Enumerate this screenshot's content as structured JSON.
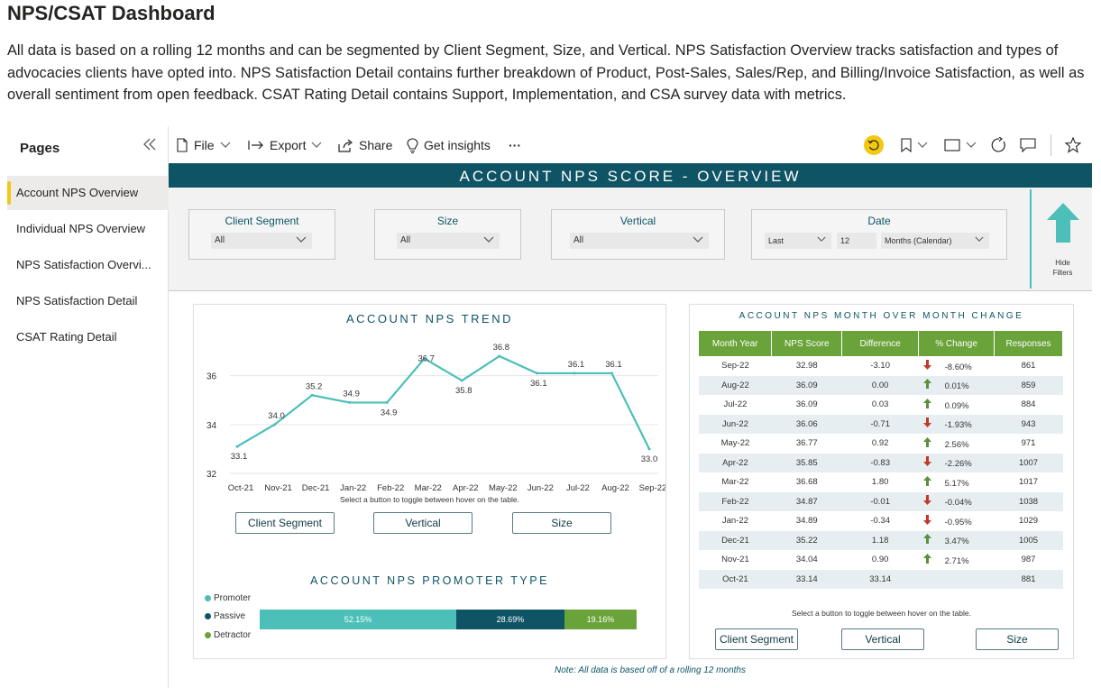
{
  "page": {
    "title": "NPS/CSAT Dashboard",
    "description": "All data is based on a rolling 12 months and can be segmented by Client Segment, Size, and Vertical. NPS Satisfaction Overview tracks satisfaction and types of advocacies clients have opted into. NPS Satisfaction Detail contains further breakdown of Product, Post-Sales, Sales/Rep, and Billing/Invoice Satisfaction, as well as overall sentiment from open feedback. CSAT Rating Detail contains Support, Implementation, and CSA survey data with metrics."
  },
  "pages_panel": {
    "header": "Pages",
    "items": [
      {
        "label": "Account NPS Overview",
        "active": true
      },
      {
        "label": "Individual NPS Overview",
        "active": false
      },
      {
        "label": "NPS Satisfaction Overvi...",
        "active": false
      },
      {
        "label": "NPS Satisfaction Detail",
        "active": false
      },
      {
        "label": "CSAT Rating Detail",
        "active": false
      }
    ]
  },
  "toolbar": {
    "file": "File",
    "export": "Export",
    "share": "Share",
    "insights": "Get insights",
    "more": "···"
  },
  "report": {
    "banner": "ACCOUNT NPS SCORE - OVERVIEW",
    "filters": {
      "client_segment": {
        "title": "Client Segment",
        "value": "All"
      },
      "size": {
        "title": "Size",
        "value": "All"
      },
      "vertical": {
        "title": "Vertical",
        "value": "All"
      },
      "date": {
        "title": "Date",
        "relative": "Last",
        "count": "12",
        "unit": "Months (Calendar)"
      },
      "hide_label_1": "Hide",
      "hide_label_2": "Filters"
    },
    "trend": {
      "title": "ACCOUNT NPS TREND",
      "hint": "Select a button to toggle between hover on the table.",
      "buttons": [
        "Client Segment",
        "Vertical",
        "Size"
      ]
    },
    "promoter": {
      "title": "ACCOUNT NPS PROMOTER TYPE",
      "legend": [
        {
          "label": "Promoter",
          "color": "#4bbfb8"
        },
        {
          "label": "Passive",
          "color": "#0e5465"
        },
        {
          "label": "Detractor",
          "color": "#6aa339"
        }
      ],
      "segments": [
        {
          "label": "52.15%",
          "value": 52.15,
          "color": "#4bbfb8"
        },
        {
          "label": "28.69%",
          "value": 28.69,
          "color": "#0e5465"
        },
        {
          "label": "19.16%",
          "value": 19.16,
          "color": "#6aa339"
        }
      ]
    },
    "mom": {
      "title": "ACCOUNT NPS MONTH OVER MONTH CHANGE",
      "headers": [
        "Month Year",
        "NPS Score",
        "Difference",
        "% Change",
        "Responses"
      ],
      "rows": [
        {
          "month": "Sep-22",
          "score": "32.98",
          "diff": "-3.10",
          "dir": "down",
          "pct": "-8.60%",
          "resp": "861"
        },
        {
          "month": "Aug-22",
          "score": "36.09",
          "diff": "0.00",
          "dir": "up",
          "pct": "0.01%",
          "resp": "859"
        },
        {
          "month": "Jul-22",
          "score": "36.09",
          "diff": "0.03",
          "dir": "up",
          "pct": "0.09%",
          "resp": "884"
        },
        {
          "month": "Jun-22",
          "score": "36.06",
          "diff": "-0.71",
          "dir": "down",
          "pct": "-1.93%",
          "resp": "943"
        },
        {
          "month": "May-22",
          "score": "36.77",
          "diff": "0.92",
          "dir": "up",
          "pct": "2.56%",
          "resp": "971"
        },
        {
          "month": "Apr-22",
          "score": "35.85",
          "diff": "-0.83",
          "dir": "down",
          "pct": "-2.26%",
          "resp": "1007"
        },
        {
          "month": "Mar-22",
          "score": "36.68",
          "diff": "1.80",
          "dir": "up",
          "pct": "5.17%",
          "resp": "1017"
        },
        {
          "month": "Feb-22",
          "score": "34.87",
          "diff": "-0.01",
          "dir": "down",
          "pct": "-0.04%",
          "resp": "1038"
        },
        {
          "month": "Jan-22",
          "score": "34.89",
          "diff": "-0.34",
          "dir": "down",
          "pct": "-0.95%",
          "resp": "1029"
        },
        {
          "month": "Dec-21",
          "score": "35.22",
          "diff": "1.18",
          "dir": "up",
          "pct": "3.47%",
          "resp": "1005"
        },
        {
          "month": "Nov-21",
          "score": "34.04",
          "diff": "0.90",
          "dir": "up",
          "pct": "2.71%",
          "resp": "987"
        },
        {
          "month": "Oct-21",
          "score": "33.14",
          "diff": "33.14",
          "dir": "",
          "pct": "",
          "resp": "881"
        }
      ],
      "hint": "Select a button to toggle between hover on the table.",
      "buttons": [
        "Client Segment",
        "Vertical",
        "Size"
      ]
    },
    "note": "Note: All data is based off of a rolling 12 months"
  },
  "colors": {
    "teal": "#4bbfb8",
    "dark_teal": "#0e5465",
    "green": "#6aa339",
    "down_red": "#c0392b",
    "up_green": "#5a8f3c"
  },
  "chart_data": {
    "type": "line",
    "title": "ACCOUNT NPS TREND",
    "categories": [
      "Oct-21",
      "Nov-21",
      "Dec-21",
      "Jan-22",
      "Feb-22",
      "Mar-22",
      "Apr-22",
      "May-22",
      "Jun-22",
      "Jul-22",
      "Aug-22",
      "Sep-22"
    ],
    "values": [
      33.1,
      34.0,
      35.2,
      34.9,
      34.9,
      36.7,
      35.8,
      36.8,
      36.1,
      36.1,
      36.1,
      33.0
    ],
    "labels": [
      "33.1",
      "34.0",
      "35.2",
      "34.9",
      "34.9",
      "36.7",
      "35.8",
      "36.8",
      "36.1",
      "36.1",
      "36.1",
      "33.0"
    ],
    "yticks": [
      "32",
      "34",
      "36"
    ],
    "ylim": [
      32,
      37.5
    ],
    "grid": true,
    "color": "#4bbfb8"
  }
}
